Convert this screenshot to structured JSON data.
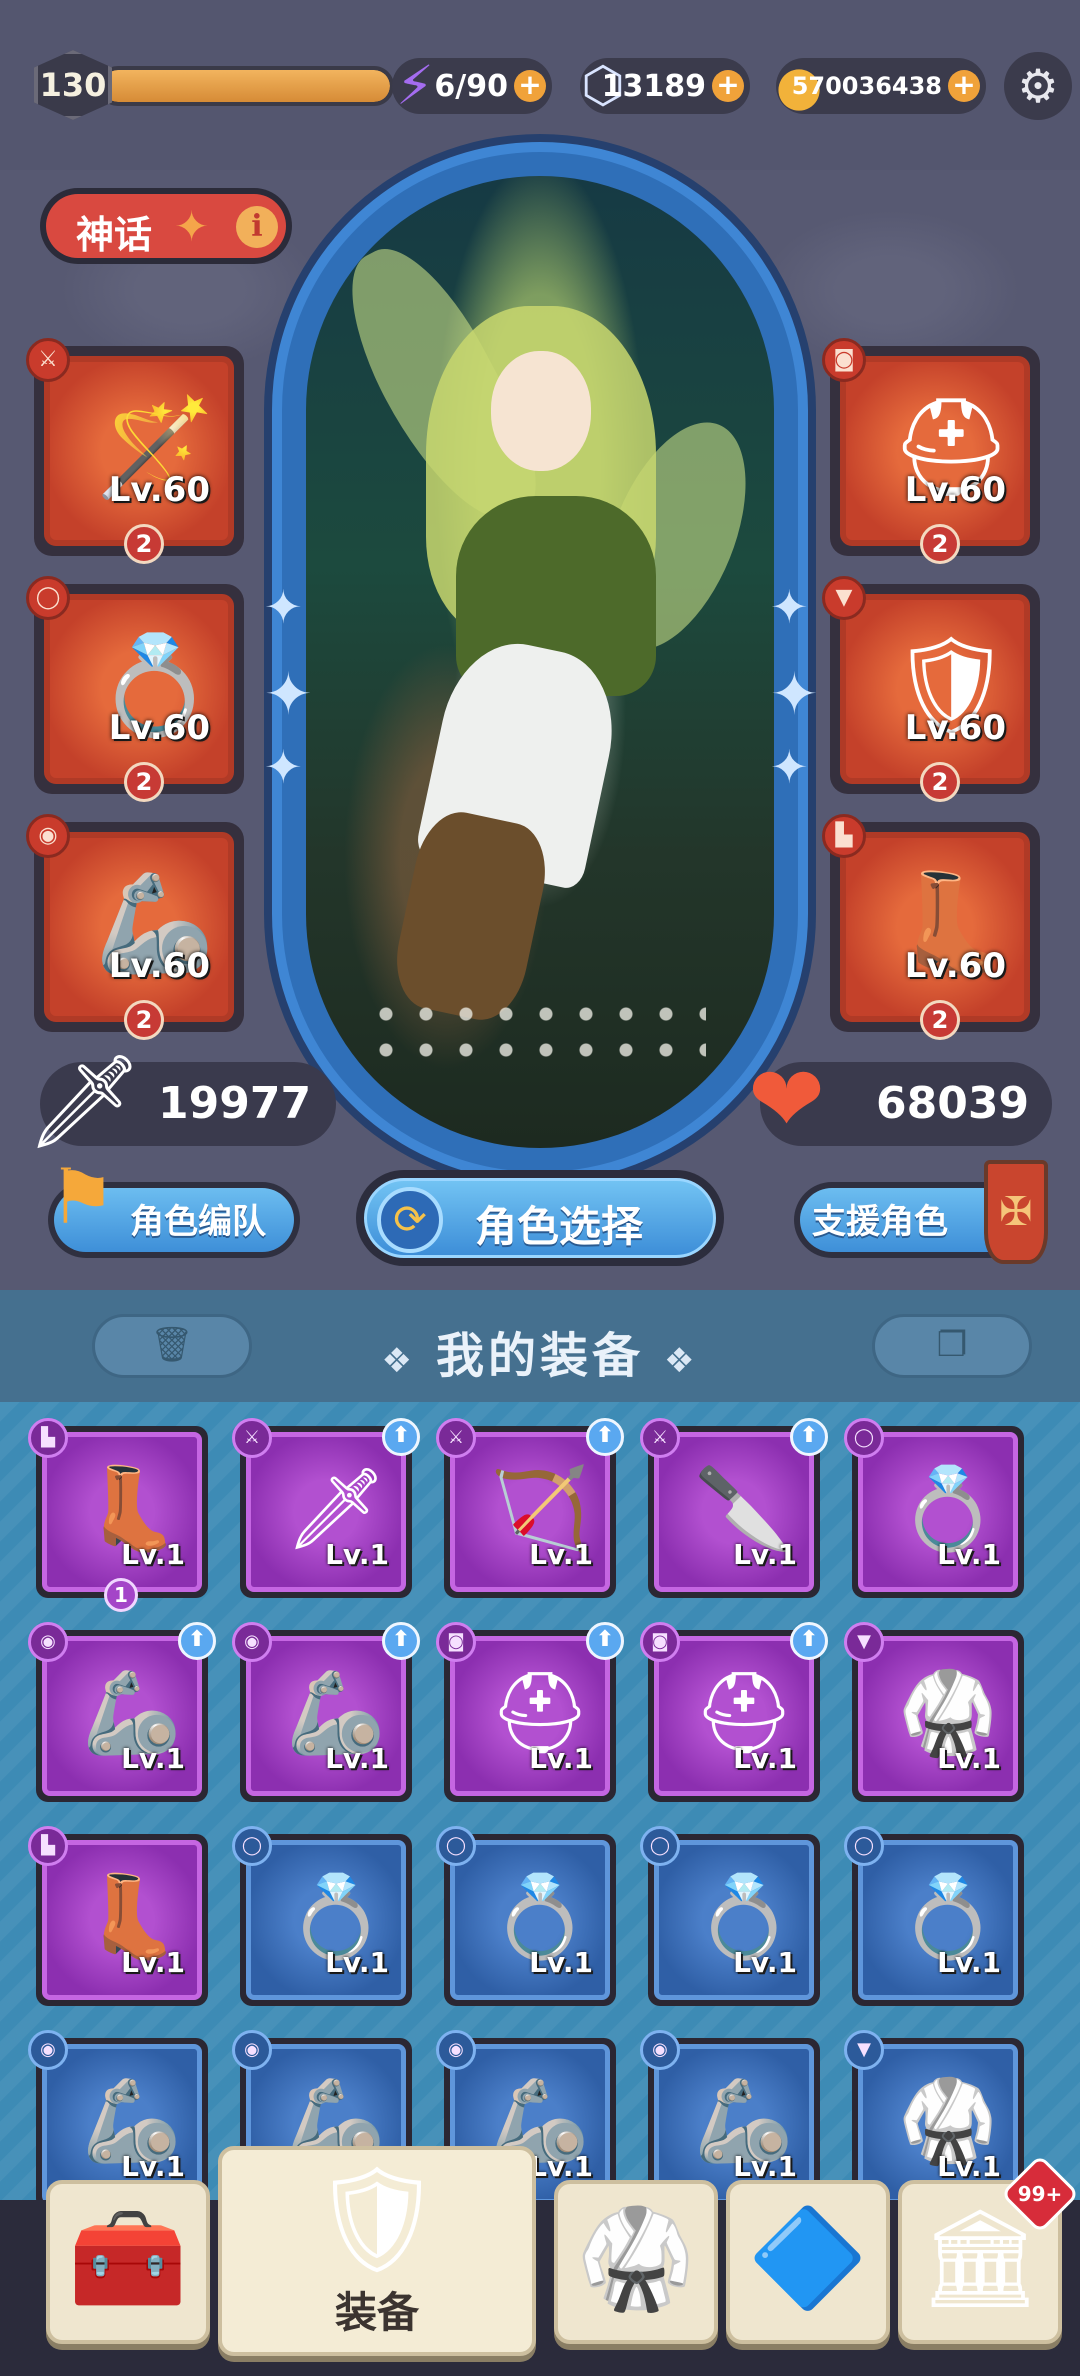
{
  "topbar": {
    "level": "130",
    "exp_progress": 1.0,
    "energy": {
      "icon": "lightning-icon",
      "value": "6/90",
      "plus": "+"
    },
    "gems": {
      "icon": "gem-icon",
      "value": "13189",
      "plus": "+"
    },
    "gold": {
      "icon": "gold-coin-icon",
      "value": "570036438",
      "plus": "+"
    },
    "settings_icon": "gear-icon"
  },
  "character": {
    "rarity_label": "神话",
    "rarity_info": "i",
    "attack": "19977",
    "hp": "68039",
    "left_slots": [
      {
        "type": "weapon",
        "level": "Lv.60",
        "stars": "2"
      },
      {
        "type": "ring",
        "level": "Lv.60",
        "stars": "2"
      },
      {
        "type": "bracer",
        "level": "Lv.60",
        "stars": "2"
      }
    ],
    "right_slots": [
      {
        "type": "helmet",
        "level": "Lv.60",
        "stars": "2"
      },
      {
        "type": "armor",
        "level": "Lv.60",
        "stars": "2"
      },
      {
        "type": "boots",
        "level": "Lv.60",
        "stars": "2"
      }
    ]
  },
  "buttons": {
    "team": "角色编队",
    "select": "角色选择",
    "support": "支援角色"
  },
  "inventory": {
    "title": "我的装备",
    "items": [
      {
        "rarity": "epic",
        "type": "boots",
        "level": "Lv.1",
        "upgrade": false,
        "star": "1"
      },
      {
        "rarity": "epic",
        "type": "sword",
        "level": "Lv.1",
        "upgrade": true,
        "star": ""
      },
      {
        "rarity": "epic",
        "type": "bow",
        "level": "Lv.1",
        "upgrade": true,
        "star": ""
      },
      {
        "rarity": "epic",
        "type": "dagger",
        "level": "Lv.1",
        "upgrade": true,
        "star": ""
      },
      {
        "rarity": "epic",
        "type": "ring",
        "level": "Lv.1",
        "upgrade": false,
        "star": ""
      },
      {
        "rarity": "epic",
        "type": "bracer",
        "level": "Lv.1",
        "upgrade": true,
        "star": ""
      },
      {
        "rarity": "epic",
        "type": "bracer",
        "level": "Lv.1",
        "upgrade": true,
        "star": ""
      },
      {
        "rarity": "epic",
        "type": "helmet",
        "level": "Lv.1",
        "upgrade": true,
        "star": ""
      },
      {
        "rarity": "epic",
        "type": "helmet",
        "level": "Lv.1",
        "upgrade": true,
        "star": ""
      },
      {
        "rarity": "epic",
        "type": "armor",
        "level": "Lv.1",
        "upgrade": false,
        "star": ""
      },
      {
        "rarity": "epic",
        "type": "boots",
        "level": "Lv.1",
        "upgrade": false,
        "star": ""
      },
      {
        "rarity": "rare",
        "type": "ring",
        "level": "Lv.1",
        "upgrade": false,
        "star": ""
      },
      {
        "rarity": "rare",
        "type": "ring",
        "level": "Lv.1",
        "upgrade": false,
        "star": ""
      },
      {
        "rarity": "rare",
        "type": "ring",
        "level": "Lv.1",
        "upgrade": false,
        "star": ""
      },
      {
        "rarity": "rare",
        "type": "ring",
        "level": "Lv.1",
        "upgrade": false,
        "star": ""
      },
      {
        "rarity": "rare",
        "type": "bracer",
        "level": "Lv.1",
        "upgrade": false,
        "star": ""
      },
      {
        "rarity": "rare",
        "type": "bracer",
        "level": "Lv.1",
        "upgrade": false,
        "star": ""
      },
      {
        "rarity": "rare",
        "type": "bracer",
        "level": "Lv.1",
        "upgrade": false,
        "star": ""
      },
      {
        "rarity": "rare",
        "type": "bracer",
        "level": "Lv.1",
        "upgrade": false,
        "star": ""
      },
      {
        "rarity": "rare",
        "type": "armor",
        "level": "Lv.1",
        "upgrade": false,
        "star": ""
      }
    ]
  },
  "nav": {
    "items": [
      {
        "icon": "treasure-chest-icon",
        "label": ""
      },
      {
        "icon": "sword-shield-icon",
        "label": "装备"
      },
      {
        "icon": "armor-icon",
        "label": ""
      },
      {
        "icon": "skill-tree-icon",
        "label": ""
      },
      {
        "icon": "shop-building-icon",
        "label": ""
      }
    ],
    "badge": "99+"
  }
}
